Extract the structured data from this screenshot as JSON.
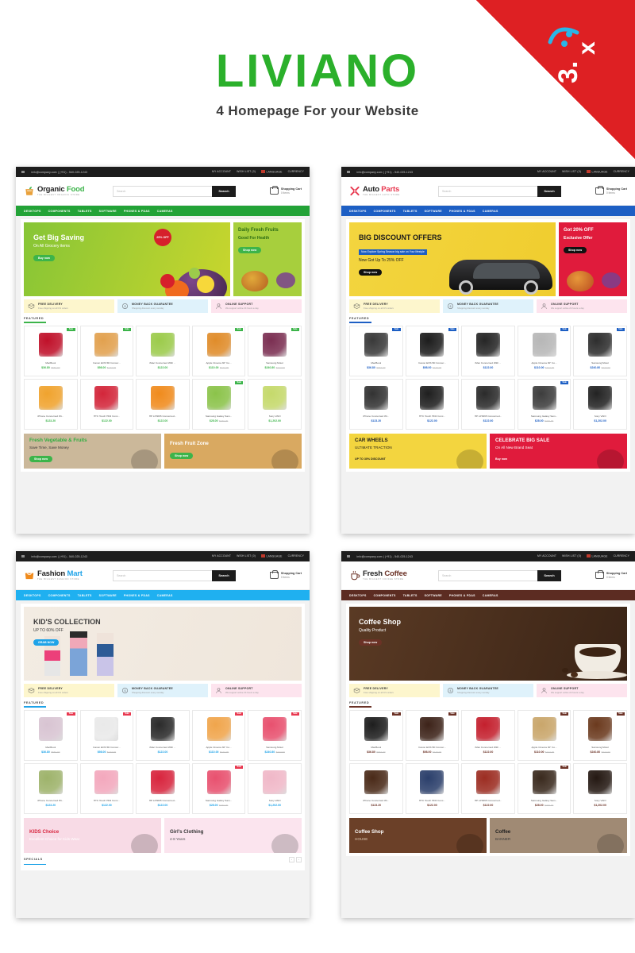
{
  "hero": {
    "brand": "LIVIANO",
    "tagline": "4 Homepage For your Website",
    "badge_version": "3.x",
    "accent_green": "#2bb02b",
    "badge_red": "#de2023"
  },
  "topbar": {
    "email": "info@company.com | (+91) - 540-025-1243",
    "account": "MY ACCOUNT",
    "wishlist": "WISH LIST (0)",
    "language": "LANGUAGE",
    "currency": "CURRENCY"
  },
  "common": {
    "search_placeholder": "Search",
    "search_button": "Search",
    "cart_label": "Shopping Cart",
    "cart_items": "0 items",
    "nav": [
      "DESKTOPS",
      "COMPONENTS",
      "TABLETS",
      "SOFTWARE",
      "PHONES & PDAS",
      "CAMERAS"
    ],
    "featured_heading": "FEATURED",
    "specials_heading": "SPECIALS",
    "services": [
      {
        "title": "FREE DELIVERY",
        "sub": "Free shipping on all US orders",
        "icon": "box-icon",
        "bg": "#fdf6cd"
      },
      {
        "title": "MONEY BACK GUARANTEE",
        "sub": "Shopping discount every sunday",
        "icon": "coin-icon",
        "bg": "#dff2fb"
      },
      {
        "title": "ONLINE SUPPORT",
        "sub": "We support online 24 hours a day",
        "icon": "support-icon",
        "bg": "#fde4ee"
      }
    ],
    "sale_tag": "Sale"
  },
  "themes": [
    {
      "id": "organic-food",
      "logo_name_a": "Organic",
      "logo_name_b": "Food",
      "logo_tagline": "THE BIGGEST ORGANIC STORE",
      "logo_color_a": "#232323",
      "logo_color_b": "#3cb44a",
      "nav_bg": "#23a337",
      "accent": "#3cb44a",
      "tag_bg": "#3cb44a",
      "banner": {
        "title": "Get Big Saving",
        "title2": "On All Grocery items",
        "btn": "Buy now",
        "badge": "25% OFF",
        "bg_from": "#86c536",
        "bg_to": "#c9d62d",
        "text_color": "#ffffff"
      },
      "side_banner": {
        "line1": "Daily Fresh  Fruits",
        "line2": "Good For Health",
        "btn": "Shop now",
        "bg": "#a7cf3d",
        "text_color": "#2b6b14",
        "btn_bg": "#3cb44a"
      },
      "products_row1": [
        {
          "name": "MacBook",
          "price": "$36.80",
          "old": "$662.00",
          "tag": "Sale",
          "color": "#c0112a"
        },
        {
          "name": "Canon EOS 5D Concer...",
          "price": "$98.00",
          "old": "$133.00",
          "tag": "Sale",
          "color": "#e2a14f"
        },
        {
          "name": "iMac Concerned With ...",
          "price": "$122.00",
          "old": "",
          "tag": "",
          "color": "#9ccb4b"
        },
        {
          "name": "Apple Cinema 30\" Co...",
          "price": "$110.00",
          "old": "$122.00",
          "tag": "Sale",
          "color": "#e08c2a"
        },
        {
          "name": "Samsung Motor",
          "price": "$240.80",
          "old": "$242.00",
          "tag": "Sale",
          "color": "#7b2f52"
        }
      ],
      "products_row2": [
        {
          "name": "iPhone Concerned Wi...",
          "price": "$123.20",
          "old": "",
          "tag": "",
          "color": "#f0a32e"
        },
        {
          "name": "HTC Touch HD2 Conc...",
          "price": "$122.00",
          "old": "",
          "tag": "",
          "color": "#d3263a"
        },
        {
          "name": "HP LP3065 Concerned...",
          "price": "$122.00",
          "old": "",
          "tag": "",
          "color": "#f08b1d"
        },
        {
          "name": "Samsung Galaxy Sam...",
          "price": "$28.00",
          "old": "$240.00",
          "tag": "Sale",
          "color": "#8bc34a"
        },
        {
          "name": "Sony VAIO",
          "price": "$1,202.00",
          "old": "",
          "tag": "",
          "color": "#c5d96b"
        }
      ],
      "bottom_banners": [
        {
          "title": "Fresh Vegetable & Fruits",
          "sub": "Save Time, Save Money",
          "btn": "Shop now",
          "bg": "#cbb89a",
          "title_color": "#2fae3f",
          "sub_color": "#333333",
          "btn_bg": "#3cb44a"
        },
        {
          "title": "Fresh Fruit Zone",
          "sub": "",
          "btn": "Shop now",
          "bg": "#d9a961",
          "title_color": "#ffffff",
          "sub_color": "#ffffff",
          "btn_bg": "#3cb44a"
        }
      ]
    },
    {
      "id": "auto-parts",
      "logo_name_a": "Auto",
      "logo_name_b": "Parts",
      "logo_tagline": "THE BIGGEST AUTO STORE",
      "logo_color_a": "#232323",
      "logo_color_b": "#e8384f",
      "nav_bg": "#1d5fc4",
      "accent": "#1d5fc4",
      "tag_bg": "#1d5fc4",
      "banner": {
        "title": "BIG DISCOUNT OFFERS",
        "title2": "Now Got Up To 25% OFF",
        "btn": "Shop now",
        "badge": "Now Explore Spring Season big sale on Your lifestyle",
        "bg_from": "#f3d53f",
        "bg_to": "#f0cd2e",
        "text_color": "#1b1b1b"
      },
      "side_banner": {
        "line1": "Got 20% OFF",
        "line2": "Exclusive Offer",
        "btn": "Shop now",
        "bg": "#e01b3c",
        "text_color": "#ffffff",
        "btn_bg": "#111111"
      },
      "products_row1": [
        {
          "name": "MacBook",
          "price": "$36.80",
          "old": "$662.00",
          "tag": "Sale",
          "color": "#3a3a3a"
        },
        {
          "name": "Canon EOS 5D Concer...",
          "price": "$98.00",
          "old": "$133.00",
          "tag": "Sale",
          "color": "#1d1d1d"
        },
        {
          "name": "iMac Concerned With ...",
          "price": "$122.00",
          "old": "",
          "tag": "",
          "color": "#262626"
        },
        {
          "name": "Apple Cinema 30\" Co...",
          "price": "$110.00",
          "old": "$122.00",
          "tag": "Sale",
          "color": "#b7b7b7"
        },
        {
          "name": "Samsung Motor",
          "price": "$240.80",
          "old": "$242.00",
          "tag": "Sale",
          "color": "#2e2e2e"
        }
      ],
      "products_row2": [
        {
          "name": "iPhone Concerned Wi...",
          "price": "$123.20",
          "old": "",
          "tag": "",
          "color": "#333333"
        },
        {
          "name": "HTC Touch HD2 Conc...",
          "price": "$122.00",
          "old": "",
          "tag": "",
          "color": "#1f1f1f"
        },
        {
          "name": "HP LP3065 Concerned...",
          "price": "$122.00",
          "old": "",
          "tag": "",
          "color": "#2b2b2b"
        },
        {
          "name": "Samsung Galaxy Sam...",
          "price": "$28.00",
          "old": "$240.00",
          "tag": "Sale",
          "color": "#3d3d3d"
        },
        {
          "name": "Sony VAIO",
          "price": "$1,202.00",
          "old": "",
          "tag": "",
          "color": "#232323"
        }
      ],
      "bottom_banners": [
        {
          "title": "CAR WHEELS",
          "sub": "ULTIMATE TRACTION",
          "btn": "UP TO 30% DISCOUNT",
          "bg": "#f3d53f",
          "title_color": "#1b1b1b",
          "sub_color": "#1b1b1b",
          "btn_bg": "transparent"
        },
        {
          "title": "CELEBRATE BIG SALE",
          "sub": "On All New Brand Seat",
          "btn": "Buy now",
          "bg": "#e01b3c",
          "title_color": "#ffffff",
          "sub_color": "#ffffff",
          "btn_bg": "transparent"
        }
      ]
    },
    {
      "id": "fashion-mart",
      "logo_name_a": "Fashion",
      "logo_name_b": "Mart",
      "logo_tagline": "THE BIGGEST FASHION STORE",
      "logo_color_a": "#232323",
      "logo_color_b": "#1fa3e8",
      "nav_bg": "#1fb0f0",
      "accent": "#1fa3e8",
      "tag_bg": "#e8384f",
      "banner": {
        "title": "KID'S COLLECTION",
        "title2": "UP TO 60% OFF",
        "btn": "GRAB NOW",
        "badge": "",
        "bg_from": "#f3ece3",
        "bg_to": "#efe6db",
        "text_color": "#3b3b3b"
      },
      "side_banner": null,
      "products_row1": [
        {
          "name": "MacBook",
          "price": "$36.80",
          "old": "$662.00",
          "tag": "Sale",
          "color": "#d8c4d2"
        },
        {
          "name": "Canon EOS 5D Concer...",
          "price": "$98.00",
          "old": "$133.00",
          "tag": "Sale",
          "color": "#e9e9e9"
        },
        {
          "name": "iMac Concerned With ...",
          "price": "$122.00",
          "old": "",
          "tag": "",
          "color": "#2b2b2b"
        },
        {
          "name": "Apple Cinema 30\" Co...",
          "price": "$110.00",
          "old": "$122.00",
          "tag": "Sale",
          "color": "#f0a54c"
        },
        {
          "name": "Samsung Motor",
          "price": "$240.80",
          "old": "$242.00",
          "tag": "Sale",
          "color": "#e8516f"
        }
      ],
      "products_row2": [
        {
          "name": "iPhone Concerned Wi...",
          "price": "$123.20",
          "old": "",
          "tag": "",
          "color": "#9eb36b"
        },
        {
          "name": "HTC Touch HD2 Conc...",
          "price": "$122.00",
          "old": "",
          "tag": "",
          "color": "#f3a8bd"
        },
        {
          "name": "HP LP3065 Concerned...",
          "price": "$122.00",
          "old": "",
          "tag": "",
          "color": "#d8253e"
        },
        {
          "name": "Samsung Galaxy Sam...",
          "price": "$28.00",
          "old": "$240.00",
          "tag": "Sale",
          "color": "#e8516f"
        },
        {
          "name": "Sony VAIO",
          "price": "$1,202.00",
          "old": "",
          "tag": "",
          "color": "#f0b8c8"
        }
      ],
      "bottom_banners": [
        {
          "title": "KIDS Choice",
          "sub": "Excellent Choice for Kids Wear",
          "btn": "",
          "bg": "#f8dbe6",
          "title_color": "#d8253e",
          "sub_color": "#ffffff",
          "btn_bg": "transparent"
        },
        {
          "title": "Girl's Clothing",
          "sub": "4-8 Years",
          "btn": "",
          "bg": "#fbe4ee",
          "title_color": "#333333",
          "sub_color": "#555555",
          "btn_bg": "transparent"
        }
      ]
    },
    {
      "id": "fresh-coffee",
      "logo_name_a": "Fresh",
      "logo_name_b": "Coffee",
      "logo_tagline": "THE BIGGEST COFFEE STORE",
      "logo_color_a": "#232323",
      "logo_color_b": "#6b3226",
      "nav_bg": "#5c2c22",
      "accent": "#6b3226",
      "tag_bg": "#6b3226",
      "banner": {
        "title": "Coffee Shop",
        "title2": "Quality Product",
        "btn": "Shop now",
        "badge": "",
        "bg_from": "#5a3a24",
        "bg_to": "#3a2416",
        "text_color": "#ffffff"
      },
      "side_banner": null,
      "products_row1": [
        {
          "name": "MacBook",
          "price": "$36.80",
          "old": "$662.00",
          "tag": "Sale",
          "color": "#1e1e1e"
        },
        {
          "name": "Canon EOS 5D Concer...",
          "price": "$98.00",
          "old": "$133.00",
          "tag": "Sale",
          "color": "#3d2319"
        },
        {
          "name": "iMac Concerned With ...",
          "price": "$122.00",
          "old": "",
          "tag": "",
          "color": "#c4202e"
        },
        {
          "name": "Apple Cinema 30\" Co...",
          "price": "$110.00",
          "old": "$122.00",
          "tag": "Sale",
          "color": "#c9a66b"
        },
        {
          "name": "Samsung Motor",
          "price": "$240.80",
          "old": "$242.00",
          "tag": "Sale",
          "color": "#6b3a1e"
        }
      ],
      "products_row2": [
        {
          "name": "iPhone Concerned Wi...",
          "price": "$123.20",
          "old": "",
          "tag": "",
          "color": "#4a2a18"
        },
        {
          "name": "HTC Touch HD2 Conc...",
          "price": "$122.00",
          "old": "",
          "tag": "",
          "color": "#2b3f6b"
        },
        {
          "name": "HP LP3065 Concerned...",
          "price": "$122.00",
          "old": "",
          "tag": "",
          "color": "#9c2d22"
        },
        {
          "name": "Samsung Galaxy Sam...",
          "price": "$28.00",
          "old": "$240.00",
          "tag": "Sale",
          "color": "#3a2a1e"
        },
        {
          "name": "Sony VAIO",
          "price": "$1,202.00",
          "old": "",
          "tag": "",
          "color": "#241812"
        }
      ],
      "bottom_banners": [
        {
          "title": "Coffee Shop",
          "sub": "HOUSE",
          "btn": "",
          "bg": "#6b4028",
          "title_color": "#ffffff",
          "sub_color": "#e0cdb8",
          "btn_bg": "transparent"
        },
        {
          "title": "Coffee",
          "sub": "BANNER",
          "btn": "",
          "bg": "#a08a74",
          "title_color": "#1e1e1e",
          "sub_color": "#3b3b3b",
          "btn_bg": "transparent"
        }
      ]
    }
  ]
}
